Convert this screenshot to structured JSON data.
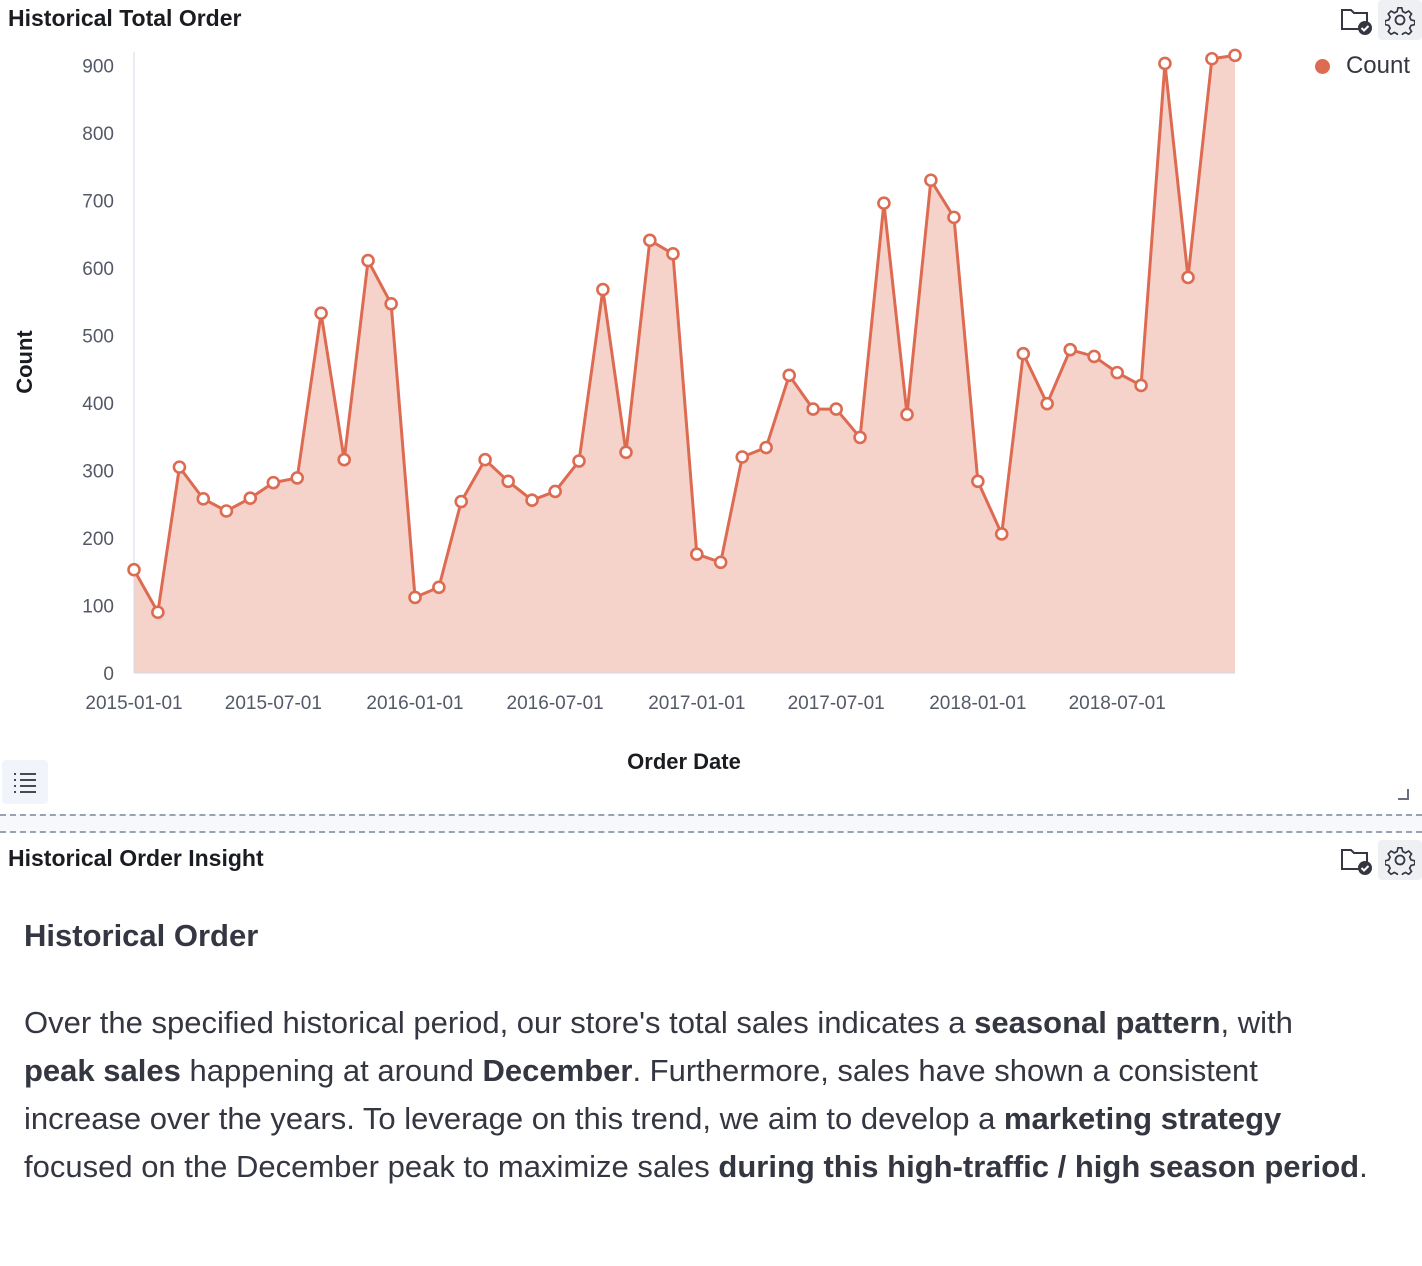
{
  "chart_panel": {
    "title": "Historical Total Order"
  },
  "insight_panel": {
    "title": "Historical Order Insight",
    "heading": "Historical Order",
    "paragraph": [
      {
        "text": "Over the specified historical period, our store's total sales indicates a ",
        "bold": false
      },
      {
        "text": "seasonal pattern",
        "bold": true
      },
      {
        "text": ", with ",
        "bold": false
      },
      {
        "text": "peak sales",
        "bold": true
      },
      {
        "text": " happening at around ",
        "bold": false
      },
      {
        "text": "December",
        "bold": true
      },
      {
        "text": ". Furthermore, sales have shown a consistent increase over the years. To leverage on this trend, we aim to develop a ",
        "bold": false
      },
      {
        "text": "marketing strategy",
        "bold": true
      },
      {
        "text": " focused on the December peak to maximize sales ",
        "bold": false
      },
      {
        "text": "during this high-traffic / high season period",
        "bold": true
      },
      {
        "text": ".",
        "bold": false
      }
    ]
  },
  "icons": {
    "save": "folder-check-icon",
    "settings": "gear-icon",
    "legend_toggle": "list-icon"
  },
  "colors": {
    "series": "#dd6b52",
    "area_fill": "#f5d3cb",
    "axis": "#d3dae6"
  },
  "chart_data": {
    "type": "area",
    "title": "Historical Total Order",
    "xlabel": "Order Date",
    "ylabel": "Count",
    "ylim": [
      0,
      920
    ],
    "y_ticks": [
      0,
      100,
      200,
      300,
      400,
      500,
      600,
      700,
      800,
      900
    ],
    "x_ticks": [
      "2015-01-01",
      "2015-07-01",
      "2016-01-01",
      "2016-07-01",
      "2017-01-01",
      "2017-07-01",
      "2018-01-01",
      "2018-07-01"
    ],
    "legend_position": "top-right",
    "grid": false,
    "series": [
      {
        "name": "Count",
        "x": [
          "2015-01-01",
          "2015-02-01",
          "2015-03-01",
          "2015-04-01",
          "2015-05-01",
          "2015-06-01",
          "2015-07-01",
          "2015-08-01",
          "2015-09-01",
          "2015-10-01",
          "2015-11-01",
          "2015-12-01",
          "2016-01-01",
          "2016-02-01",
          "2016-03-01",
          "2016-04-01",
          "2016-05-01",
          "2016-06-01",
          "2016-07-01",
          "2016-08-01",
          "2016-09-01",
          "2016-10-01",
          "2016-11-01",
          "2016-12-01",
          "2017-01-01",
          "2017-02-01",
          "2017-03-01",
          "2017-04-01",
          "2017-05-01",
          "2017-06-01",
          "2017-07-01",
          "2017-08-01",
          "2017-09-01",
          "2017-10-01",
          "2017-11-01",
          "2017-12-01",
          "2018-01-01",
          "2018-02-01",
          "2018-03-01",
          "2018-04-01",
          "2018-05-01",
          "2018-06-01",
          "2018-07-01",
          "2018-08-01",
          "2018-09-01",
          "2018-10-01",
          "2018-11-01",
          "2018-12-01"
        ],
        "values": [
          153,
          90,
          305,
          258,
          240,
          259,
          282,
          289,
          533,
          316,
          611,
          547,
          112,
          127,
          254,
          316,
          284,
          256,
          269,
          314,
          568,
          327,
          641,
          621,
          176,
          164,
          320,
          334,
          441,
          391,
          391,
          349,
          696,
          383,
          730,
          675,
          284,
          206,
          473,
          399,
          479,
          469,
          445,
          426,
          903,
          586,
          910,
          915
        ]
      }
    ]
  }
}
